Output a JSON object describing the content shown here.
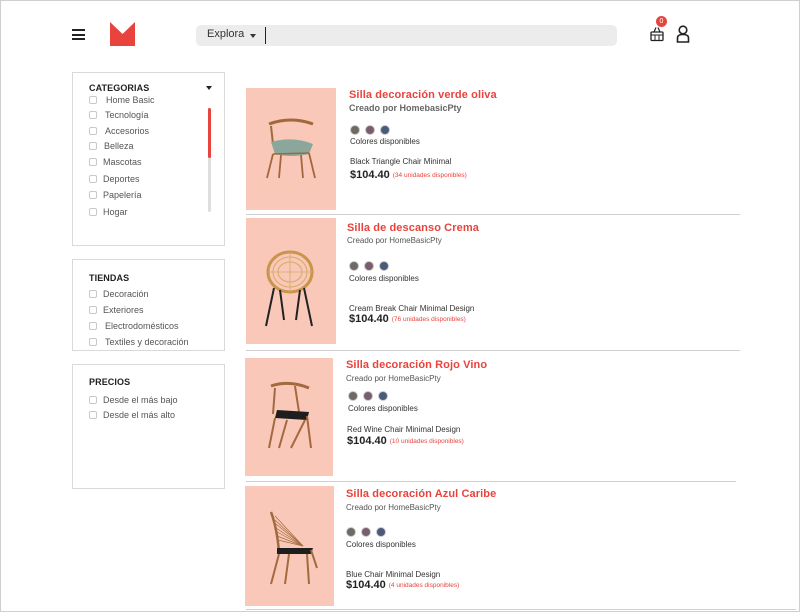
{
  "header": {
    "explore_label": "Explora",
    "search_placeholder": "",
    "cart_count": "0",
    "brand_color": "#e8433d"
  },
  "filters": {
    "categories": {
      "title": "CATEGORIAS",
      "items": [
        "Home Basic",
        "Tecnología",
        "Accesorios",
        "Belleza",
        "Mascotas",
        "Deportes",
        "Papelería",
        "Hogar"
      ]
    },
    "stores": {
      "title": "TIENDAS",
      "items": [
        "Decoración",
        "Exteriores",
        "Electrodomésticos",
        "Textiles y decoración"
      ]
    },
    "prices": {
      "title": "PRECIOS",
      "items": [
        "Desde el más bajo",
        "Desde el más alto"
      ]
    }
  },
  "products": [
    {
      "name": "Silla decoración verde oliva",
      "creator": "Creado por HomebasicPty",
      "colors_label": "Colores disponibles",
      "colors": [
        "#6d6a66",
        "#7a5d6c",
        "#4a5a7a"
      ],
      "description": "Black Triangle Chair Minimal",
      "price": "$104.40",
      "availability": "(34 unidades disponibles)",
      "icon": "chair-olive-icon"
    },
    {
      "name": "Silla de descanso Crema",
      "creator": "Creado por HomeBasicPty",
      "colors_label": "Colores disponibles",
      "colors": [
        "#6d6a66",
        "#7a5d6c",
        "#4a5a7a"
      ],
      "description": "Cream Break Chair  Minimal Design",
      "price": "$104.40",
      "availability": "(76 unidades disponibles)",
      "icon": "chair-rattan-icon"
    },
    {
      "name": "Silla decoración Rojo Vino",
      "creator": "Creado por HomeBasicPty",
      "colors_label": "Colores disponibles",
      "colors": [
        "#6d6a66",
        "#7a5d6c",
        "#4a5a7a"
      ],
      "description": "Red Wine Chair Minimal Design",
      "price": "$104.40",
      "availability": "(10 unidades disponibles)",
      "icon": "chair-wine-icon"
    },
    {
      "name": "Silla decoración Azul Caribe",
      "creator": "Creado por HomeBasicPty",
      "colors_label": "Colores disponibles",
      "colors": [
        "#6d6a66",
        "#7a5d6c",
        "#4a5a7a"
      ],
      "description": "Blue Chair Minimal Design",
      "price": "$104.40",
      "availability": "(4 unidades disponibles)",
      "icon": "chair-string-icon"
    }
  ]
}
